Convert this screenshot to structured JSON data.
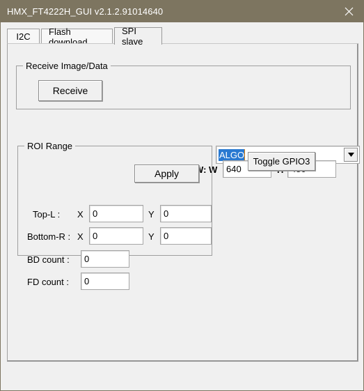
{
  "window": {
    "title": "HMX_FT4222H_GUI v2.1.2.91014640",
    "close_icon": "close-icon",
    "titlebar_color": "#7d7560",
    "background_color": "#f0f0f0"
  },
  "tabs": [
    {
      "label": "I2C",
      "active": false
    },
    {
      "label": "Flash download",
      "active": false
    },
    {
      "label": "SPI slave",
      "active": true
    }
  ],
  "receive_group": {
    "title": "Receive Image/Data",
    "receive_button": "Receive",
    "source_combo": {
      "value": "ALGO",
      "selected": true,
      "selection_color": "#2979d1",
      "caret_color": "#e8820c",
      "arrow_icon": "chevron-down-icon"
    }
  },
  "raw": {
    "label": "RAW: W",
    "width_value": "640",
    "height_label": "H",
    "height_value": "480"
  },
  "roi_group": {
    "title": "ROI Range",
    "rows": [
      {
        "label": "Top-L :",
        "x_label": "X",
        "x_value": "0",
        "y_label": "Y",
        "y_value": "0"
      },
      {
        "label": "Bottom-R :",
        "x_label": "X",
        "x_value": "0",
        "y_label": "Y",
        "y_value": "0"
      }
    ],
    "bd_label": "BD count :",
    "bd_value": "0",
    "fd_label": "FD count :",
    "fd_value": "0",
    "apply_button": "Apply"
  },
  "gpio": {
    "toggle_button": "Toggle GPIO3"
  }
}
